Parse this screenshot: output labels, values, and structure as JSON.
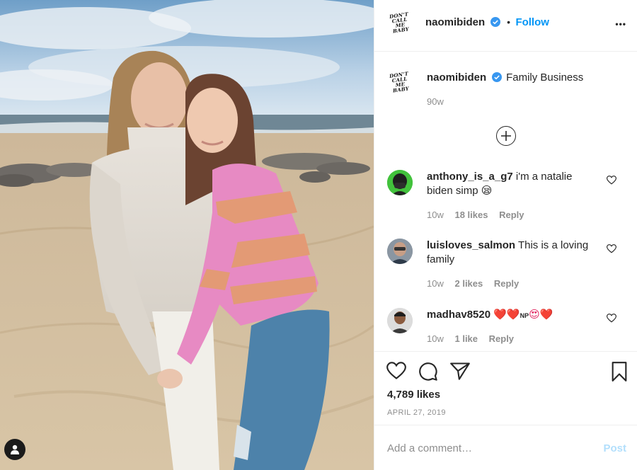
{
  "photo": {
    "alt_icon": "user-tag-icon"
  },
  "header": {
    "logo_lines": [
      "DON'T",
      "CALL ME",
      "BABY"
    ],
    "username": "naomibiden",
    "separator": "•",
    "follow_label": "Follow",
    "more_label": "•••"
  },
  "caption": {
    "username": "naomibiden",
    "text": "Family Business",
    "age": "90w"
  },
  "comments": [
    {
      "username": "anthony_is_a_g7",
      "text": "i'm a natalie biden simp",
      "emoji": "😪",
      "age": "10w",
      "likes": "18 likes",
      "reply": "Reply"
    },
    {
      "username": "luisloves_salmon",
      "text": "This is a loving family",
      "emoji": "",
      "age": "10w",
      "likes": "2 likes",
      "reply": "Reply"
    },
    {
      "username": "madhav8520",
      "text": "",
      "emoji_run": "❤️❤️",
      "np": "NP",
      "emoji_tail": "😍❤️",
      "age": "10w",
      "likes": "1 like",
      "reply": "Reply"
    }
  ],
  "actions": {
    "likes": "4,789 likes",
    "date": "APRIL 27, 2019"
  },
  "composer": {
    "placeholder": "Add a comment…",
    "post_label": "Post"
  },
  "colors": {
    "accent": "#0095f6",
    "muted": "#8e8e8e",
    "text": "#262626",
    "post_disabled": "#b2dffc"
  }
}
